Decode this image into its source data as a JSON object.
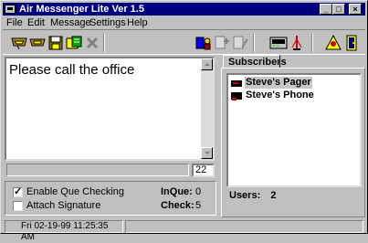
{
  "window": {
    "title": "Air Messenger Lite Ver 1.5"
  },
  "menu": [
    "File",
    "Edit",
    "Message",
    "Settings",
    "Help"
  ],
  "toolbar": {
    "icons": [
      "send-icon",
      "receive-icon",
      "save-icon",
      "address-book-icon",
      "delete-icon",
      "subscriber-icon",
      "add-subscriber-icon",
      "edit-subscriber-icon",
      "modem-icon",
      "antenna-icon",
      "alert-icon",
      "exit-icon"
    ]
  },
  "message": {
    "text": "Please call the office",
    "char_count": "22"
  },
  "options": {
    "enable_que_checking": {
      "label": "Enable Que Checking",
      "checked": true
    },
    "attach_signature": {
      "label": "Attach Signature",
      "checked": false
    }
  },
  "stats": {
    "inque_label": "InQue:",
    "inque_value": "0",
    "check_label": "Check:",
    "check_value": "5"
  },
  "subscribers": {
    "tab_label": "Subscribers",
    "items": [
      {
        "label": "Steve's Pager",
        "selected": true
      },
      {
        "label": "Steve's Phone",
        "selected": false
      }
    ],
    "users_label": "Users:",
    "users_count": "2"
  },
  "status": {
    "datetime": "Fri 02-19-99 11:25:35 AM"
  }
}
